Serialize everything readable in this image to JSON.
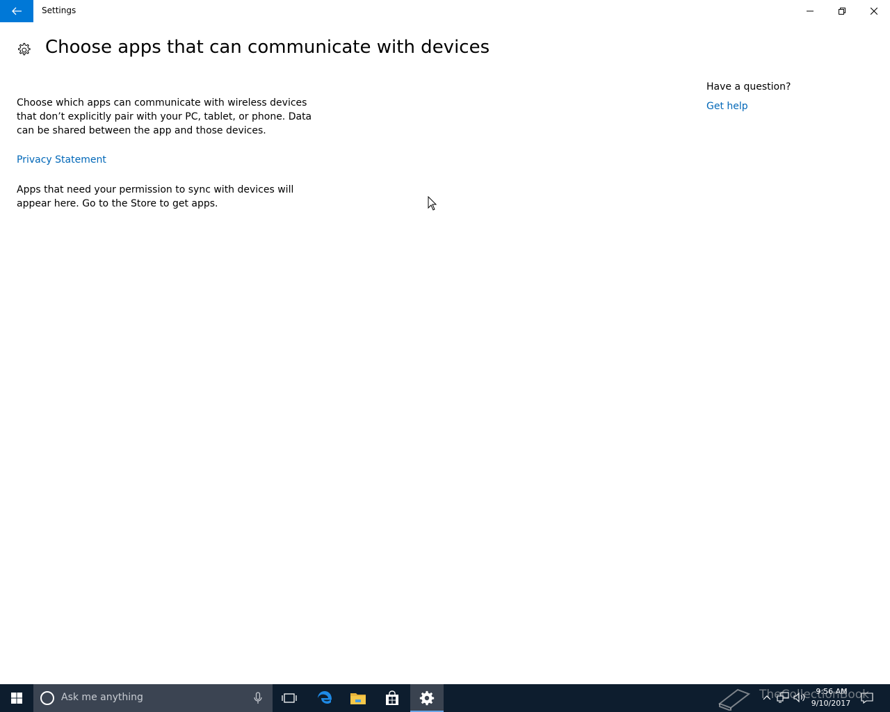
{
  "window": {
    "title": "Settings"
  },
  "page": {
    "title": "Choose apps that can communicate with devices",
    "description": "Choose which apps can communicate with wireless devices that don’t explicitly pair with your PC, tablet, or phone. Data can be shared between the app and those devices.",
    "privacy_link": "Privacy Statement",
    "empty_message": "Apps that need your permission to sync with devices will appear here. Go to the Store to get apps."
  },
  "sidebar": {
    "question": "Have a question?",
    "help_link": "Get help"
  },
  "taskbar": {
    "search_placeholder": "Ask me anything",
    "apps": [
      "task-view",
      "edge",
      "file-explorer",
      "store",
      "settings"
    ],
    "active_app": "settings",
    "watermark": "TheCollectionBook",
    "time": "9:56 AM",
    "date": "9/10/2017"
  },
  "colors": {
    "accent": "#0078d7",
    "link": "#0067b8",
    "taskbar": "#0d1d2e",
    "search_box": "#3b4452"
  }
}
